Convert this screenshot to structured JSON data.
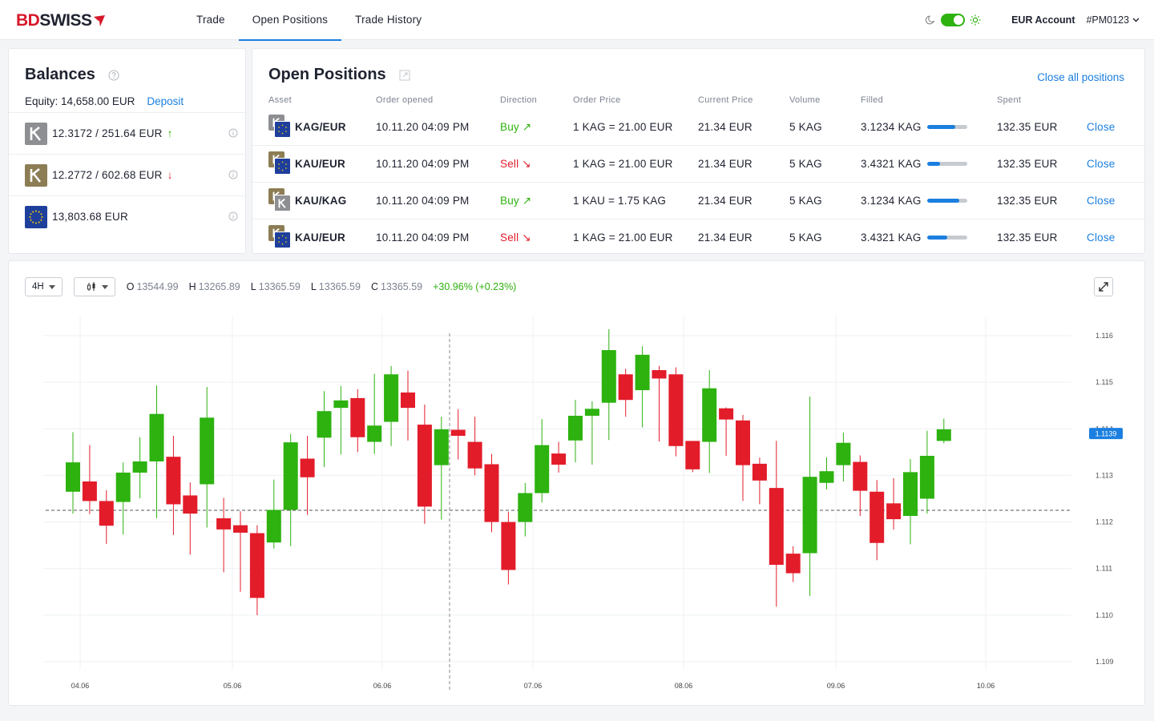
{
  "header": {
    "logo_bd": "BD",
    "logo_swiss": "SWISS",
    "nav": [
      {
        "label": "Trade",
        "active": false
      },
      {
        "label": "Open Positions",
        "active": true
      },
      {
        "label": "Trade History",
        "active": false
      }
    ],
    "account_label": "EUR Account",
    "account_id": "#PM0123"
  },
  "balances": {
    "title": "Balances",
    "equity": "Equity: 14,658.00 EUR",
    "deposit_label": "Deposit",
    "rows": [
      {
        "icon": "K",
        "value": "12.3172  /  251.64 EUR",
        "trend": "up",
        "trend_glyph": "↑"
      },
      {
        "icon": "K",
        "value": "12.2772  /  602.68 EUR",
        "trend": "down",
        "trend_glyph": "↓"
      },
      {
        "icon": "EU",
        "value": "13,803.68 EUR",
        "trend": "",
        "trend_glyph": ""
      }
    ]
  },
  "positions": {
    "title": "Open Positions",
    "close_all_label": "Close all positions",
    "columns": [
      "Asset",
      "Order opened",
      "Direction",
      "Order Price",
      "Current Price",
      "Volume",
      "Filled",
      "Spent"
    ],
    "rows": [
      {
        "asset": "KAG/EUR",
        "opened": "10.11.20 04:09 PM",
        "direction": "Buy",
        "dir_glyph": "↗",
        "order_price": "1 KAG = 21.00 EUR",
        "current_price": "21.34 EUR",
        "volume": "5 KAG",
        "filled": "3.1234 KAG",
        "filled_pct": 70,
        "spent": "132.35 EUR",
        "close_label": "Close"
      },
      {
        "asset": "KAU/EUR",
        "opened": "10.11.20 04:09 PM",
        "direction": "Sell",
        "dir_glyph": "↘",
        "order_price": "1 KAG = 21.00 EUR",
        "current_price": "21.34 EUR",
        "volume": "5 KAG",
        "filled": "3.4321 KAG",
        "filled_pct": 32,
        "spent": "132.35 EUR",
        "close_label": "Close"
      },
      {
        "asset": "KAU/KAG",
        "opened": "10.11.20 04:09 PM",
        "direction": "Buy",
        "dir_glyph": "↗",
        "order_price": "1 KAU = 1.75 KAG",
        "current_price": "21.34 EUR",
        "volume": "5 KAG",
        "filled": "3.1234 KAG",
        "filled_pct": 80,
        "spent": "132.35 EUR",
        "close_label": "Close"
      },
      {
        "asset": "KAU/EUR",
        "opened": "10.11.20 04:09 PM",
        "direction": "Sell",
        "dir_glyph": "↘",
        "order_price": "1 KAG = 21.00 EUR",
        "current_price": "21.34 EUR",
        "volume": "5 KAG",
        "filled": "3.4321 KAG",
        "filled_pct": 50,
        "spent": "132.35 EUR",
        "close_label": "Close"
      }
    ]
  },
  "chart_toolbar": {
    "interval": "4H",
    "ohlc": [
      {
        "k": "O",
        "v": "13544.99"
      },
      {
        "k": "H",
        "v": "13265.89"
      },
      {
        "k": "L",
        "v": "13365.59"
      },
      {
        "k": "L",
        "v": "13365.59"
      },
      {
        "k": "C",
        "v": "13365.59"
      }
    ],
    "change": "+30.96% (+0.23%)"
  },
  "colors": {
    "accent": "#1b7fe0",
    "up": "#2db20f",
    "down": "#e31c2a"
  },
  "chart_data": {
    "type": "candlestick",
    "x_labels": [
      "04.06",
      "05.06",
      "06.06",
      "07.06",
      "08.06",
      "09.06",
      "10.06"
    ],
    "y_ticks": [
      "1.116",
      "1.115",
      "1.114",
      "1.113",
      "1.112",
      "1.111",
      "1.110",
      "1.109"
    ],
    "ylim": [
      1.109,
      1.116
    ],
    "last_price": "1.1139",
    "reference_price": 1.11225,
    "candles": [
      [
        1.11265,
        1.11328,
        1.11393,
        1.11218
      ],
      [
        1.11287,
        1.11245,
        1.11365,
        1.11217
      ],
      [
        1.11245,
        1.11192,
        1.11268,
        1.11153
      ],
      [
        1.11243,
        1.11306,
        1.11328,
        1.11173
      ],
      [
        1.11306,
        1.1133,
        1.11382,
        1.11251
      ],
      [
        1.1133,
        1.11432,
        1.11493,
        1.11208
      ],
      [
        1.1134,
        1.11238,
        1.11385,
        1.11172
      ],
      [
        1.11257,
        1.11218,
        1.11285,
        1.1113
      ],
      [
        1.11281,
        1.11424,
        1.1149,
        1.11188
      ],
      [
        1.11208,
        1.11184,
        1.11252,
        1.11092
      ],
      [
        1.11193,
        1.11177,
        1.11223,
        1.1105
      ],
      [
        1.11176,
        1.11037,
        1.11193,
        1.11
      ],
      [
        1.11156,
        1.11226,
        1.11291,
        1.11143
      ],
      [
        1.11226,
        1.11371,
        1.11389,
        1.11148
      ],
      [
        1.11336,
        1.11296,
        1.11385,
        1.11215
      ],
      [
        1.11381,
        1.11438,
        1.11481,
        1.11318
      ],
      [
        1.11445,
        1.11461,
        1.11492,
        1.11345
      ],
      [
        1.11466,
        1.11382,
        1.11485,
        1.1135
      ],
      [
        1.11372,
        1.11407,
        1.11518,
        1.11346
      ],
      [
        1.11415,
        1.11517,
        1.11535,
        1.11363
      ],
      [
        1.11478,
        1.11445,
        1.11525,
        1.11375
      ],
      [
        1.11409,
        1.11233,
        1.11452,
        1.11196
      ],
      [
        1.11322,
        1.11399,
        1.11426,
        1.11205
      ],
      [
        1.11398,
        1.11385,
        1.11442,
        1.11334
      ],
      [
        1.11372,
        1.11315,
        1.11426,
        1.113
      ],
      [
        1.11324,
        1.112,
        1.11346,
        1.11178
      ],
      [
        1.112,
        1.11097,
        1.11222,
        1.11066
      ],
      [
        1.112,
        1.11262,
        1.11284,
        1.11169
      ],
      [
        1.11262,
        1.11365,
        1.11421,
        1.11242
      ],
      [
        1.11347,
        1.11323,
        1.11372,
        1.11306
      ],
      [
        1.11375,
        1.11428,
        1.11462,
        1.11328
      ],
      [
        1.11428,
        1.11443,
        1.11459,
        1.11323
      ],
      [
        1.11456,
        1.11569,
        1.11614,
        1.11376
      ],
      [
        1.11517,
        1.11462,
        1.11529,
        1.11426
      ],
      [
        1.11483,
        1.11559,
        1.11577,
        1.11403
      ],
      [
        1.11526,
        1.11508,
        1.11535,
        1.11373
      ],
      [
        1.11517,
        1.11363,
        1.11532,
        1.11341
      ],
      [
        1.11374,
        1.11313,
        1.11358,
        1.11307
      ],
      [
        1.11372,
        1.11487,
        1.11526,
        1.11305
      ],
      [
        1.11444,
        1.1142,
        1.11446,
        1.11342
      ],
      [
        1.11418,
        1.11322,
        1.1143,
        1.11245
      ],
      [
        1.11325,
        1.11289,
        1.11338,
        1.11238
      ],
      [
        1.11273,
        1.11108,
        1.11374,
        1.11018
      ],
      [
        1.11132,
        1.1109,
        1.11148,
        1.11071
      ],
      [
        1.11133,
        1.11297,
        1.11469,
        1.11041
      ],
      [
        1.11284,
        1.11309,
        1.11339,
        1.1127
      ],
      [
        1.11322,
        1.1137,
        1.11392,
        1.11287
      ],
      [
        1.11329,
        1.11267,
        1.11343,
        1.11213
      ],
      [
        1.11265,
        1.11155,
        1.1129,
        1.11118
      ],
      [
        1.1124,
        1.11206,
        1.11294,
        1.11184
      ],
      [
        1.11213,
        1.11307,
        1.11335,
        1.11152
      ],
      [
        1.1125,
        1.11342,
        1.11396,
        1.11218
      ],
      [
        1.11374,
        1.11399,
        1.11422,
        1.11369
      ]
    ]
  }
}
